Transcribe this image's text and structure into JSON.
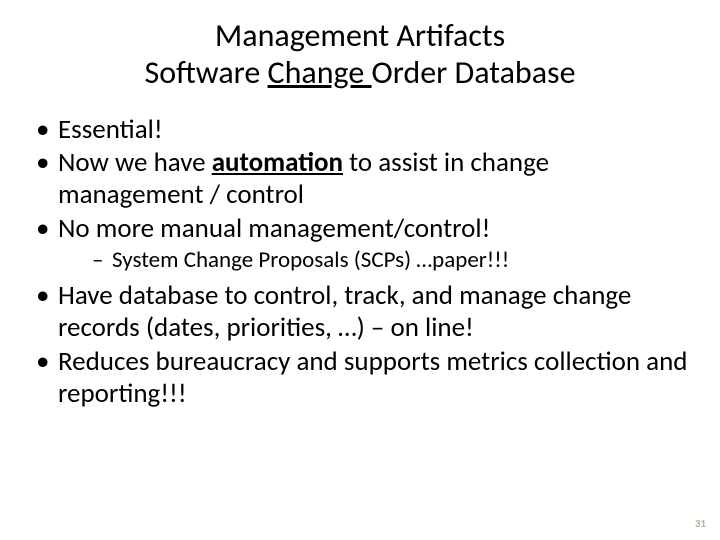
{
  "title": {
    "line1": "Management Artifacts",
    "line2_pre": "Software ",
    "line2_underlined": "Change ",
    "line2_post": "Order Database"
  },
  "bullets": {
    "b1": "Essential!",
    "b2_pre": "Now we have ",
    "b2_bold": "automation",
    "b2_post": " to assist in change management / control",
    "b3": "No more manual management/control!",
    "b3_sub": "System Change Proposals (SCPs) …paper!!!",
    "b4": "Have database to control, track, and manage change records (dates, priorities, …) – on line!",
    "b5": "Reduces bureaucracy and supports metrics collection and reporting!!!"
  },
  "page_number": "31"
}
